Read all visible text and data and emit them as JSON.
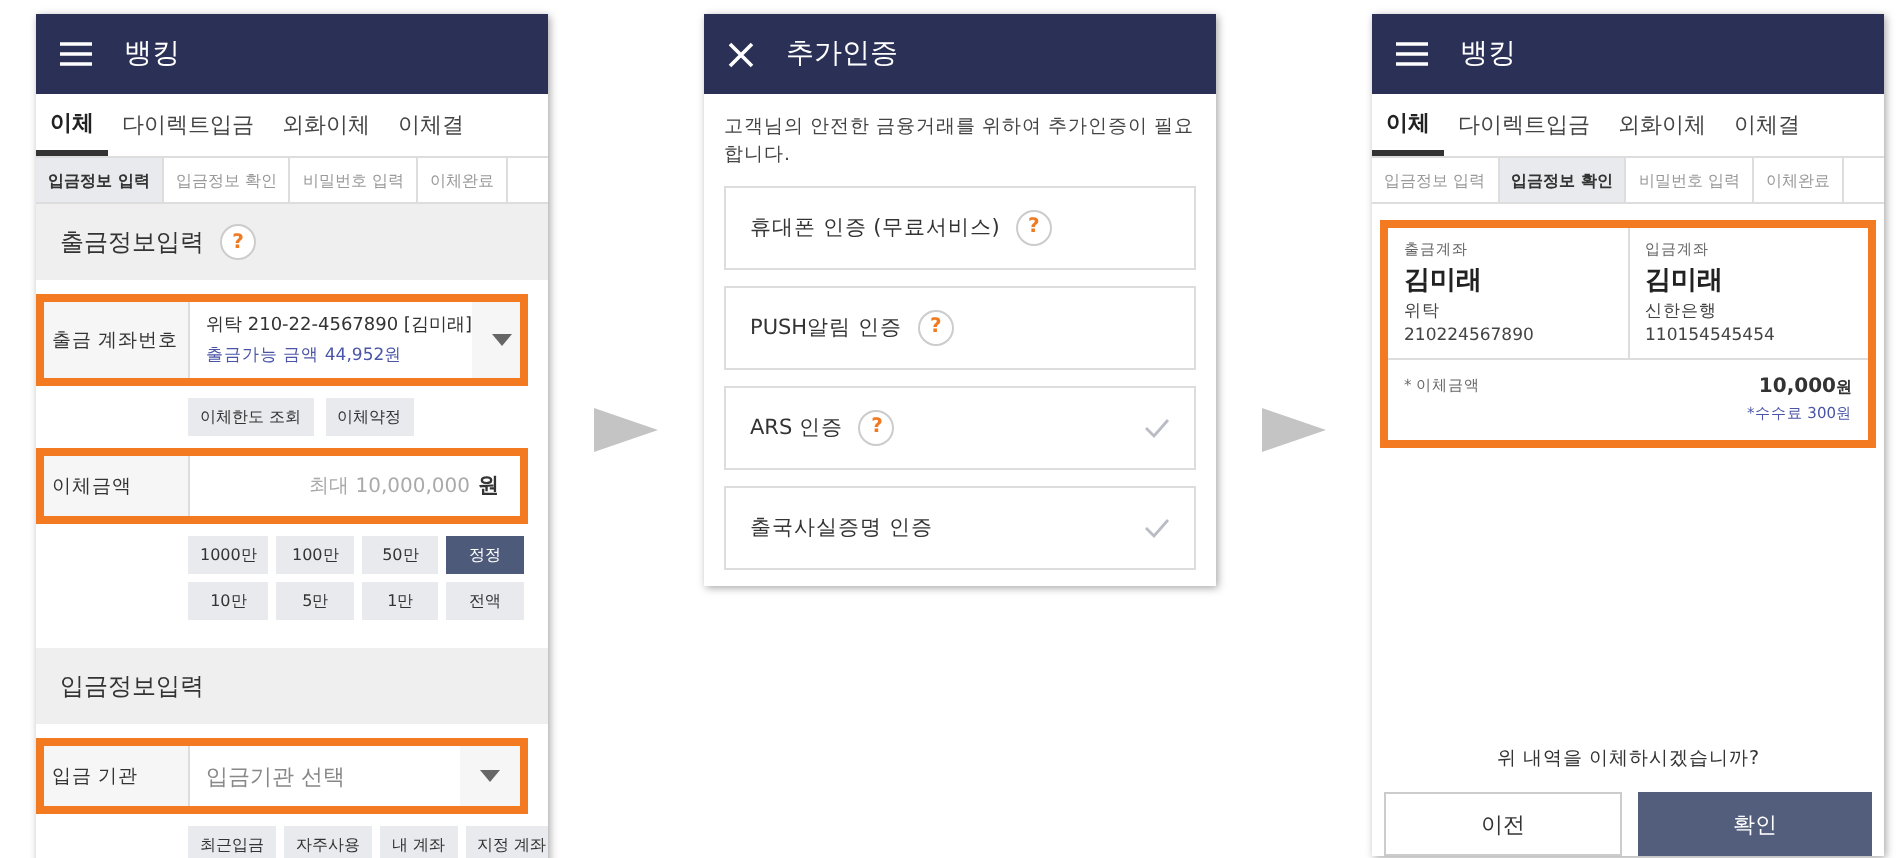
{
  "screens": [
    {
      "kind": "transfer_form",
      "header": {
        "title": "뱅킹"
      },
      "tabs": [
        {
          "label": "이체",
          "selected": true
        },
        {
          "label": "다이렉트입금",
          "selected": false
        },
        {
          "label": "외화이체",
          "selected": false
        },
        {
          "label": "이체결",
          "selected": false
        }
      ],
      "steps": [
        {
          "label": "입금정보 입력",
          "selected": true
        },
        {
          "label": "입금정보 확인",
          "selected": false
        },
        {
          "label": "비밀번호 입력",
          "selected": false
        },
        {
          "label": "이체완료",
          "selected": false
        }
      ],
      "withdraw_section": {
        "title": "출금정보입력",
        "help": "?"
      },
      "account_field": {
        "label": "출금 계좌번호",
        "value": "위탁  210-22-4567890 [김미래]",
        "available": "출금가능 금액 44,952원",
        "highlighted": true
      },
      "account_buttons": [
        "이체한도 조회",
        "이체약정"
      ],
      "amount_field": {
        "label": "이체금액",
        "placeholder": "최대 10,000,000",
        "unit": "원",
        "highlighted": true
      },
      "amount_buttons": [
        {
          "label": "1000만",
          "selected": false
        },
        {
          "label": "100만",
          "selected": false
        },
        {
          "label": "50만",
          "selected": false
        },
        {
          "label": "정정",
          "selected": true
        },
        {
          "label": "10만",
          "selected": false
        },
        {
          "label": "5만",
          "selected": false
        },
        {
          "label": "1만",
          "selected": false
        },
        {
          "label": "전액",
          "selected": false
        }
      ],
      "deposit_section": {
        "title": "입금정보입력"
      },
      "bank_field": {
        "label": "입금 기관",
        "placeholder": "입금기관 선택",
        "highlighted": true
      },
      "bank_buttons": [
        "최근입금",
        "자주사용",
        "내 계좌",
        "지정 계좌"
      ]
    },
    {
      "kind": "auth",
      "header": {
        "title": "추가인증"
      },
      "description": "고객님의 안전한 금융거래를 위하여 추가인증이 필요합니다.",
      "options": [
        {
          "label": "휴대폰 인증 (무료서비스)",
          "help": "?",
          "checked": false
        },
        {
          "label": "PUSH알림 인증",
          "help": "?",
          "checked": false
        },
        {
          "label": "ARS 인증",
          "help": "?",
          "checked": true
        },
        {
          "label": "출국사실증명 인증",
          "checked": true
        }
      ]
    },
    {
      "kind": "confirm",
      "header": {
        "title": "뱅킹"
      },
      "tabs": [
        {
          "label": "이체",
          "selected": true
        },
        {
          "label": "다이렉트입금",
          "selected": false
        },
        {
          "label": "외화이체",
          "selected": false
        },
        {
          "label": "이체결",
          "selected": false
        }
      ],
      "steps": [
        {
          "label": "입금정보 입력",
          "selected": false
        },
        {
          "label": "입금정보 확인",
          "selected": true
        },
        {
          "label": "비밀번호 입력",
          "selected": false
        },
        {
          "label": "이체완료",
          "selected": false
        }
      ],
      "summary": {
        "highlighted": true,
        "accounts": [
          {
            "label": "출금계좌",
            "name": "김미래",
            "bank": "위탁",
            "number": "210224567890"
          },
          {
            "label": "입금계좌",
            "name": "김미래",
            "bank": "신한은행",
            "number": "110154545454"
          }
        ],
        "amount_label": "* 이체금액",
        "amount": "10,000",
        "unit": "원",
        "fee": "*수수료 300원"
      },
      "question": "위 내역을 이체하시겠습니까?",
      "buttons": [
        {
          "label": "이전",
          "kind": "secondary"
        },
        {
          "label": "확인",
          "kind": "primary"
        }
      ]
    }
  ]
}
